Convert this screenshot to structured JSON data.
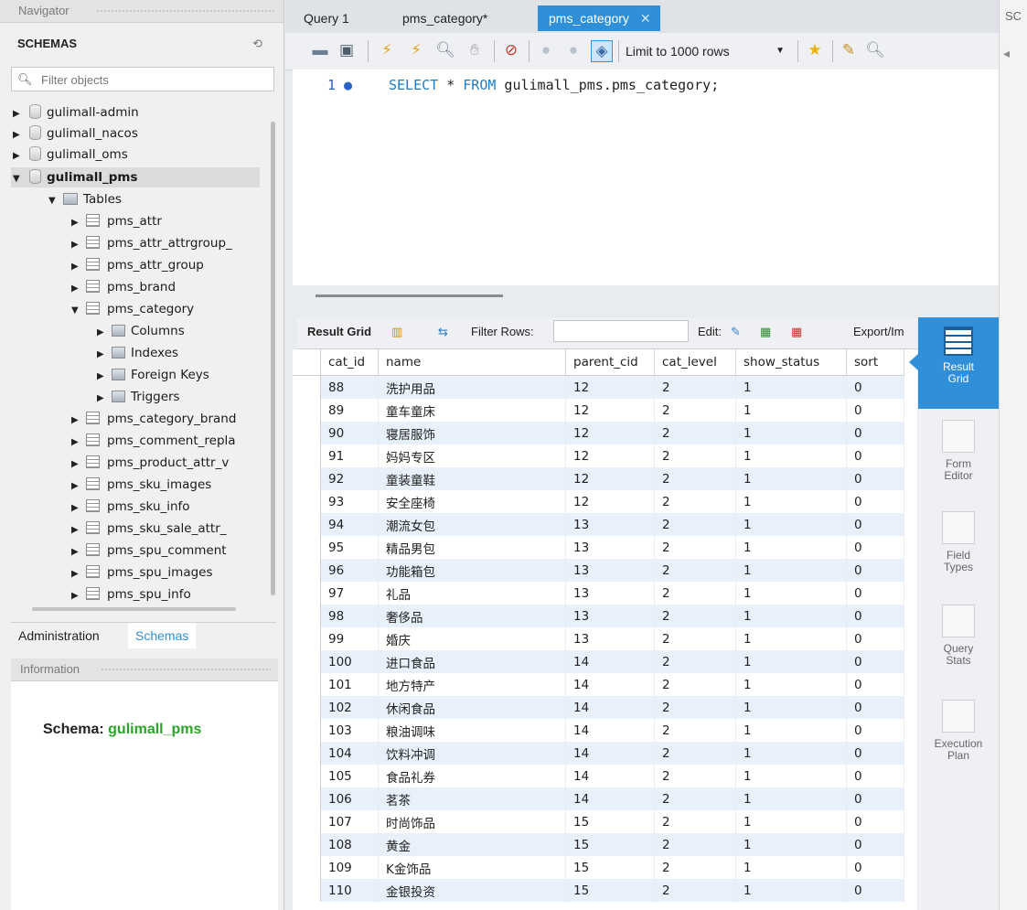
{
  "navigator": {
    "title": "Navigator",
    "schemas_label": "SCHEMAS",
    "filter_placeholder": "Filter objects",
    "databases": [
      {
        "name": "gulimall-admin"
      },
      {
        "name": "gulimall_nacos"
      },
      {
        "name": "gulimall_oms"
      },
      {
        "name": "gulimall_pms"
      }
    ],
    "tables_folder": "Tables",
    "tables": [
      "pms_attr",
      "pms_attr_attrgroup_",
      "pms_attr_group",
      "pms_brand",
      "pms_category",
      "pms_category_brand",
      "pms_comment_repla",
      "pms_product_attr_v",
      "pms_sku_images",
      "pms_sku_info",
      "pms_sku_sale_attr_",
      "pms_spu_comment",
      "pms_spu_images",
      "pms_spu_info"
    ],
    "category_children": [
      "Columns",
      "Indexes",
      "Foreign Keys",
      "Triggers"
    ],
    "tabs": [
      "Administration",
      "Schemas"
    ],
    "info_title": "Information",
    "schema_label": "Schema:",
    "schema_value": "gulimall_pms"
  },
  "editor": {
    "tabs": [
      "Query 1",
      "pms_category*",
      "pms_category"
    ],
    "limit_label": "Limit to 1000 rows",
    "line_number": "1",
    "sql": {
      "kw1": "SELECT",
      "star": " * ",
      "kw2": "FROM",
      "rest": " gulimall_pms.pms_category;"
    }
  },
  "result": {
    "grid_label": "Result Grid",
    "filter_label": "Filter Rows:",
    "edit_label": "Edit:",
    "export_label": "Export/Im",
    "columns": [
      "cat_id",
      "name",
      "parent_cid",
      "cat_level",
      "show_status",
      "sort"
    ],
    "rows": [
      [
        "88",
        "洗护用品",
        "12",
        "2",
        "1",
        "0"
      ],
      [
        "89",
        "童车童床",
        "12",
        "2",
        "1",
        "0"
      ],
      [
        "90",
        "寝居服饰",
        "12",
        "2",
        "1",
        "0"
      ],
      [
        "91",
        "妈妈专区",
        "12",
        "2",
        "1",
        "0"
      ],
      [
        "92",
        "童装童鞋",
        "12",
        "2",
        "1",
        "0"
      ],
      [
        "93",
        "安全座椅",
        "12",
        "2",
        "1",
        "0"
      ],
      [
        "94",
        "潮流女包",
        "13",
        "2",
        "1",
        "0"
      ],
      [
        "95",
        "精品男包",
        "13",
        "2",
        "1",
        "0"
      ],
      [
        "96",
        "功能箱包",
        "13",
        "2",
        "1",
        "0"
      ],
      [
        "97",
        "礼品",
        "13",
        "2",
        "1",
        "0"
      ],
      [
        "98",
        "奢侈品",
        "13",
        "2",
        "1",
        "0"
      ],
      [
        "99",
        "婚庆",
        "13",
        "2",
        "1",
        "0"
      ],
      [
        "100",
        "进口食品",
        "14",
        "2",
        "1",
        "0"
      ],
      [
        "101",
        "地方特产",
        "14",
        "2",
        "1",
        "0"
      ],
      [
        "102",
        "休闲食品",
        "14",
        "2",
        "1",
        "0"
      ],
      [
        "103",
        "粮油调味",
        "14",
        "2",
        "1",
        "0"
      ],
      [
        "104",
        "饮料冲调",
        "14",
        "2",
        "1",
        "0"
      ],
      [
        "105",
        "食品礼券",
        "14",
        "2",
        "1",
        "0"
      ],
      [
        "106",
        "茗茶",
        "14",
        "2",
        "1",
        "0"
      ],
      [
        "107",
        "时尚饰品",
        "15",
        "2",
        "1",
        "0"
      ],
      [
        "108",
        "黄金",
        "15",
        "2",
        "1",
        "0"
      ],
      [
        "109",
        "K金饰品",
        "15",
        "2",
        "1",
        "0"
      ],
      [
        "110",
        "金银投资",
        "15",
        "2",
        "1",
        "0"
      ]
    ]
  },
  "side_panel": {
    "buttons": [
      "Result Grid",
      "Form Editor",
      "Field Types",
      "Query Stats",
      "Execution Plan"
    ]
  },
  "right_panel_label": "SC",
  "colors": {
    "accent": "#2f8fd8",
    "schema_value": "#2aa52a",
    "keyword": "#1d7cc8"
  }
}
